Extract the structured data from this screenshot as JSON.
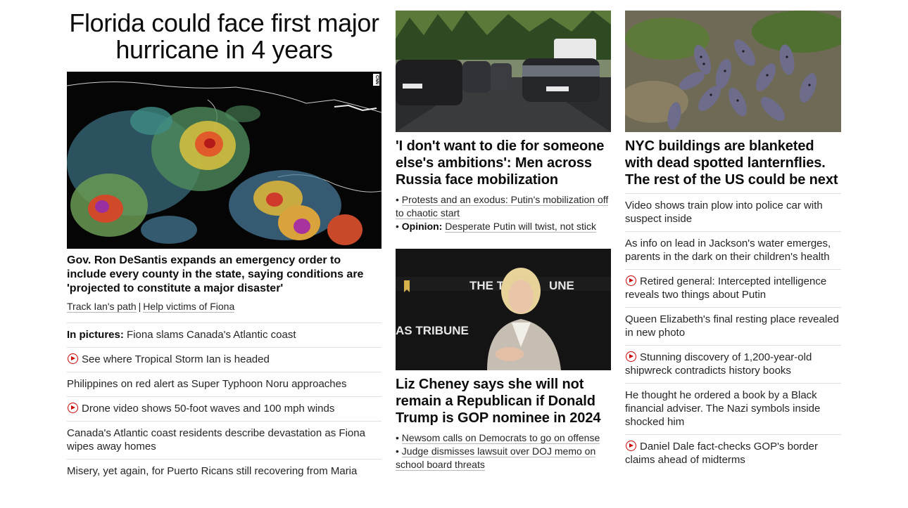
{
  "lead": {
    "title": "Florida could face first major hurricane in 4 years",
    "image_alt": "Satellite image of storm",
    "image_badge": "CNN",
    "subtitle": "Gov. Ron DeSantis expands an emergency order to include every county in the state, saying conditions are 'projected to constitute a major disaster'",
    "link1": "Track Ian's path",
    "link_sep": "|",
    "link2": "Help victims of Fiona",
    "items": [
      {
        "prefix": "In pictures:",
        "text": "Fiona slams Canada's Atlantic coast",
        "video": false
      },
      {
        "prefix": "",
        "text": "See where Tropical Storm Ian is headed",
        "video": true
      },
      {
        "prefix": "",
        "text": "Philippines on red alert as Super Typhoon Noru approaches",
        "video": false
      },
      {
        "prefix": "",
        "text": "Drone video shows 50-foot waves and 100 mph winds",
        "video": true
      },
      {
        "prefix": "",
        "text": "Canada's Atlantic coast residents describe devastation as Fiona wipes away homes",
        "video": false
      },
      {
        "prefix": "",
        "text": "Misery, yet again, for Puerto Ricans still recovering from Maria",
        "video": false
      }
    ]
  },
  "middle": {
    "story1": {
      "headline": "'I don't want to die for someone else's ambitions': Men across Russia face mobilization",
      "bullets": [
        {
          "prefix": "",
          "text": "Protests and an exodus: Putin's mobilization off to chaotic start"
        },
        {
          "prefix": "Opinion:",
          "text": "Desperate Putin will twist, not stick"
        }
      ]
    },
    "story2": {
      "image_text_top": "THE TEX",
      "image_text_top2": "UNE",
      "image_text_bottom": "AS TRIBUNE",
      "headline": "Liz Cheney says she will not remain a Republican if Donald Trump is GOP nominee in 2024",
      "bullets": [
        {
          "prefix": "",
          "text": "Newsom calls on Democrats to go on offense"
        },
        {
          "prefix": "",
          "text": "Judge dismisses lawsuit over DOJ memo on school board threats"
        }
      ]
    }
  },
  "right": {
    "headline": "NYC buildings are blanketed with dead spotted lanternflies. The rest of the US could be next",
    "items": [
      {
        "text": "Video shows train plow into police car with suspect inside",
        "video": false
      },
      {
        "text": "As info on lead in Jackson's water emerges, parents in the dark on their children's health",
        "video": false
      },
      {
        "text": "Retired general: Intercepted intelligence reveals two things about Putin",
        "video": true
      },
      {
        "text": "Queen Elizabeth's final resting place revealed in new photo",
        "video": false
      },
      {
        "text": "Stunning discovery of 1,200-year-old shipwreck contradicts history books",
        "video": true
      },
      {
        "text": "He thought he ordered a book by a Black financial adviser. The Nazi symbols inside shocked him",
        "video": false
      },
      {
        "text": "Daniel Dale fact-checks GOP's border claims ahead of midterms",
        "video": true
      }
    ]
  },
  "colors": {
    "text": "#0c0c0c",
    "video_red": "#cc0000",
    "divider": "#e0e0e0"
  }
}
